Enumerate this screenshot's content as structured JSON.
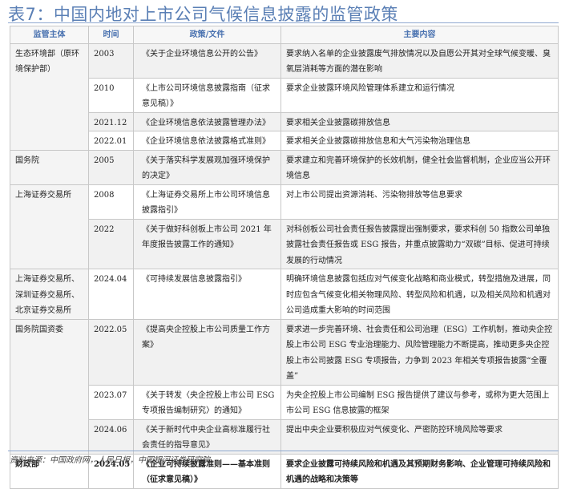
{
  "title": "表7：中国内地对上市公司气候信息披露的监管政策",
  "headers": [
    "监管主体",
    "时间",
    "政策/文件",
    "主要内容"
  ],
  "groups": [
    {
      "agency": "生态环境部（原环境保护部）",
      "rows": [
        {
          "time": "2003",
          "doc": "《关于企业环境信息公开的公告》",
          "content": "要求纳入名单的企业披露废气排放情况以及自愿公开其对全球气候变暖、臭氧层消耗等方面的潜在影响"
        },
        {
          "time": "2010",
          "doc": "《上市公司环境信息披露指南（征求意见稿）》",
          "content": "要求企业披露环境风险管理体系建立和运行情况"
        },
        {
          "time": "2021.12",
          "doc": "《企业环境信息依法披露管理办法》",
          "content": "要求相关企业披露碳排放信息"
        },
        {
          "time": "2022.01",
          "doc": "《企业环境信息依法披露格式准则》",
          "content": "要求相关企业披露碳排放信息和大气污染物治理信息"
        }
      ]
    },
    {
      "agency": "国务院",
      "rows": [
        {
          "time": "2005",
          "doc": "《关于落实科学发展观加强环境保护的决定》",
          "content": "要求建立和完善环境保护的长效机制，健全社会监督机制，企业应当公开环境信息"
        }
      ]
    },
    {
      "agency": "上海证券交易所",
      "rows": [
        {
          "time": "2008",
          "doc": "《上海证券交易所上市公司环境信息披露指引》",
          "content": "对上市公司提出资源消耗、污染物排放等信息要求"
        },
        {
          "time": "2022",
          "doc": "《关于做好科创板上市公司 2021 年年度报告披露工作的通知》",
          "content": "对科创板公司社会责任报告披露提出强制要求，要求科创 50 指数公司单独披露社会责任报告或 ESG 报告，并重点披露助力“双碳”目标、促进可持续发展的行动情况"
        }
      ]
    },
    {
      "agency": "上海证券交易所、深圳证券交易所、北京证券交易所",
      "rows": [
        {
          "time": "2024.04",
          "doc": "《可持续发展信息披露指引》",
          "content": "明确环境信息披露包括应对气候变化战略和商业模式，转型措施及进展，同时应包含气候变化相关物理风险、转型风险和机遇，以及相关风险和机遇对公司造成重大影响的时间范围"
        }
      ]
    },
    {
      "agency": "国务院国资委",
      "rows": [
        {
          "time": "2022.05",
          "doc": "《提高央企控股上市公司质量工作方案》",
          "content": "要求进一步完善环境、社会责任和公司治理（ESG）工作机制，推动央企控股上市公司 ESG 专业治理能力、风险管理能力不断提高，推动更多央企控股上市公司披露 ESG 专项报告，力争到 2023 年相关专项报告披露“全覆盖”"
        },
        {
          "time": "2023.07",
          "doc": "《关于转发〈央企控股上市公司 ESG 专项报告编制研究〉的通知》",
          "content": "为央企控股上市公司编制 ESG 报告提供了建议与参考，或称为更大范围上市公司 ESG 信息披露的框架"
        },
        {
          "time": "2024.06",
          "doc": "《关于新时代中央企业高标准履行社会责任的指导意见》",
          "content": "提出中央企业要积极应对气候变化、严密防控环境风险等要求"
        }
      ]
    },
    {
      "agency": "财政部",
      "bold": true,
      "rows": [
        {
          "time": "2024.05",
          "doc": "《企业可持续披露准则——基本准则（征求意见稿）》",
          "content": "要求企业披露可持续风险和机遇及其预期财务影响、企业管理可持续风险和机遇的战略和决策等"
        }
      ]
    }
  ],
  "source": "资料来源：中国政府网，人民日报，中国银河证券研究院"
}
